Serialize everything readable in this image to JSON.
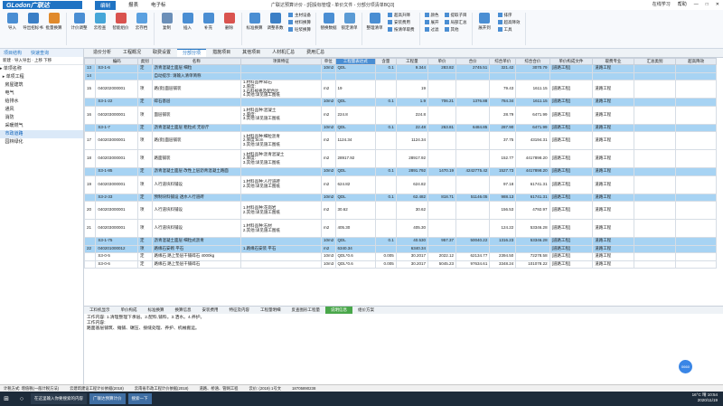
{
  "app": {
    "logo": "GLodon广联达",
    "window_title": "广联达预算计价 - [招投标管理 - 单价文件 - 分部分项清单BQ3]",
    "menu": [
      "编制",
      "报表",
      "电子标"
    ],
    "right": [
      "在线学习",
      "帮助"
    ]
  },
  "ribbon": {
    "big": [
      "导入",
      "导出招标书",
      "批量换算",
      "计价调整",
      "云检查",
      "智能组价",
      "云存档",
      "复制",
      "插入",
      "补充",
      "删除",
      "标准换算",
      "调整系数",
      "主材设备",
      "材料换算",
      "砼浆换算",
      "替换数据",
      "锁定清单",
      "整理清单",
      "排序",
      "超高降效",
      "展开到",
      "局部汇总",
      "工具"
    ],
    "small": [
      "超高升降",
      "安装费用",
      "按清单取费",
      "提取子目",
      "颜色",
      "展开",
      "过滤",
      "其他"
    ]
  },
  "left": {
    "tabs": [
      "项目结构",
      "快速查询"
    ],
    "toolbar": "新建 · 导入导出 · 上移 下移",
    "tree": [
      "▸ 单项名称",
      "  ▸ 单项工程",
      "    房屋建筑",
      "    电气",
      "    给排水",
      "    通风",
      "    消防",
      "    采暖燃气",
      "    市政道路",
      "    园林绿化"
    ]
  },
  "main_tabs": [
    "造价分析",
    "工程概况",
    "取费设置",
    "分部分项",
    "措施项目",
    "其他项目",
    "人材机汇总",
    "费用汇总"
  ],
  "columns": [
    "",
    "编码",
    "类别",
    "名称",
    "项目特征",
    "单位",
    "工程量表达式",
    "含量",
    "工程量",
    "单价",
    "合价",
    "综合单价",
    "综合合价",
    "单价构成文件",
    "取费专业",
    "汇总类别",
    "超高降效"
  ],
  "rows": [
    {
      "c": "blue",
      "n": "13",
      "code": "S3-1-6",
      "lb": "定",
      "name": "沥青混凝土面层 细粒",
      "tz": "",
      "dw": "10m2",
      "expr": "QDL",
      "hl": "0.1",
      "gcl": "9.344",
      "dj": "283.82",
      "hj": "2745.51",
      "zhdj": "321.42",
      "zhhj": "3070.79",
      "wj": "[道路工程]",
      "zy": "道路工程"
    },
    {
      "c": "blue",
      "n": "14",
      "code": "",
      "lb": "",
      "name": "自动提示: 请输入清单简称",
      "tz": "",
      "dw": "",
      "expr": "",
      "hl": "",
      "gcl": "",
      "dj": "",
      "hj": "",
      "zhdj": "",
      "zhhj": "",
      "wj": "",
      "zy": ""
    },
    {
      "c": "white",
      "n": "15",
      "code": "040202000001",
      "lb": "项",
      "name": "路(街)面层铺装",
      "tz": "1.材料品种:碎石\n2.厚度:\n3.石料规格及配合比\n4.其他:详见施工图纸",
      "dw": "m2",
      "expr": "19",
      "hl": "",
      "gcl": "19",
      "dj": "",
      "hj": "",
      "zhdj": "79.43",
      "zhhj": "1611.15",
      "wj": "[道路工程]",
      "zy": "道路工程"
    },
    {
      "c": "blue",
      "n": "",
      "code": "S3-1-22",
      "lb": "定",
      "name": "碎石基层",
      "tz": "",
      "dw": "10m2",
      "expr": "QDL",
      "hl": "0.1",
      "gcl": "1.9",
      "dj": "706.21",
      "hj": "1376.88",
      "zhdj": "784.34",
      "zhhj": "1611.15",
      "wj": "[道路工程]",
      "zy": "道路工程"
    },
    {
      "c": "white",
      "n": "16",
      "code": "040203000001",
      "lb": "项",
      "name": "面层铺装",
      "tz": "1.材料品种:混凝土\n2.厚度:\n3.其他:详见施工图纸",
      "dw": "m2",
      "expr": "224.8",
      "hl": "",
      "gcl": "224.8",
      "dj": "",
      "hj": "",
      "zhdj": "28.79",
      "zhhj": "6471.99",
      "wj": "[道路工程]",
      "zy": "道路工程"
    },
    {
      "c": "blue",
      "n": "",
      "code": "S3-1-7",
      "lb": "定",
      "name": "沥青混凝土面层 粗粒式 无砂斤",
      "tz": "",
      "dw": "10m2",
      "expr": "QDL",
      "hl": "0.1",
      "gcl": "22.48",
      "dj": "263.81",
      "hj": "6484.85",
      "zhdj": "287.90",
      "zhhj": "6471.99",
      "wj": "[道路工程]",
      "zy": "道路工程"
    },
    {
      "c": "white",
      "n": "17",
      "code": "040203000001",
      "lb": "项",
      "name": "路(街)面层铺装",
      "tz": "1.材料品种:细粒沥青\n2.厚度:5cm\n3.其他:详见施工图纸",
      "dw": "m2",
      "expr": "1124.34",
      "hl": "",
      "gcl": "1124.34",
      "dj": "",
      "hj": "",
      "zhdj": "37.75",
      "zhhj": "43194.31",
      "wj": "[道路工程]",
      "zy": "道路工程"
    },
    {
      "c": "white",
      "n": "18",
      "code": "040203000001",
      "lb": "项",
      "name": "路面铺装",
      "tz": "1.材料品种:沥青混凝土\n2.厚度:\n3.其他:详见施工图纸",
      "dw": "m2",
      "expr": "28917.92",
      "hl": "",
      "gcl": "28917.92",
      "dj": "",
      "hj": "",
      "zhdj": "152.77",
      "zhhj": "4417898.20",
      "wj": "[道路工程]",
      "zy": "道路工程"
    },
    {
      "c": "blue",
      "n": "",
      "code": "S3-1-85",
      "lb": "定",
      "name": "沥青混凝土面层 改性上层沥青混凝土路面",
      "tz": "",
      "dw": "10m2",
      "expr": "QDL",
      "hl": "0.1",
      "gcl": "2891.792",
      "dj": "1470.19",
      "hj": "4242775.42",
      "zhdj": "1527.73",
      "zhhj": "4417898.20",
      "wj": "[道路工程]",
      "zy": "道路工程"
    },
    {
      "c": "white",
      "n": "19",
      "code": "040203000001",
      "lb": "项",
      "name": "人行道块料铺设",
      "tz": "1.材料品种:人行道砖\n2.其他:详见施工图纸",
      "dw": "m2",
      "expr": "624.82",
      "hl": "",
      "gcl": "624.82",
      "dj": "",
      "hj": "",
      "zhdj": "97.18",
      "zhhj": "61741.31",
      "wj": "[道路工程]",
      "zy": "道路工程"
    },
    {
      "c": "blue",
      "n": "",
      "code": "S3-2-33",
      "lb": "定",
      "name": "预制块料铺设 透水人行道砖",
      "tz": "",
      "dw": "10m2",
      "expr": "QDL",
      "hl": "0.1",
      "gcl": "62.482",
      "dj": "818.71",
      "hj": "51146.05",
      "zhdj": "988.13",
      "zhhj": "61741.31",
      "wj": "[道路工程]",
      "zy": "道路工程"
    },
    {
      "c": "white",
      "n": "20",
      "code": "040203000001",
      "lb": "项",
      "name": "人行道块料铺设",
      "tz": "1.材料品种:花岗岩\n2.其他:详见施工图纸",
      "dw": "m2",
      "expr": "30.62",
      "hl": "",
      "gcl": "30.62",
      "dj": "",
      "hj": "",
      "zhdj": "156.53",
      "zhhj": "4792.97",
      "wj": "[道路工程]",
      "zy": "道路工程"
    },
    {
      "c": "white",
      "n": "21",
      "code": "040203000001",
      "lb": "项",
      "name": "人行道块料铺设",
      "tz": "1.材料品种:石材\n2.其他:详见施工图纸",
      "dw": "m2",
      "expr": "405.30",
      "hl": "",
      "gcl": "405.30",
      "dj": "",
      "hj": "",
      "zhdj": "124.22",
      "zhhj": "53346.28",
      "wj": "[道路工程]",
      "zy": "道路工程"
    },
    {
      "c": "blue",
      "n": "",
      "code": "S3-1-75",
      "lb": "定",
      "name": "沥青混凝土面层 细粒式沥青",
      "tz": "",
      "dw": "10m2",
      "expr": "QDL",
      "hl": "0.1",
      "gcl": "40.530",
      "dj": "957.37",
      "hj": "50040.22",
      "zhdj": "1316.23",
      "zhhj": "53346.28",
      "wj": "[道路工程]",
      "zy": "道路工程"
    },
    {
      "c": "blue",
      "n": "22",
      "code": "040201000012",
      "lb": "项",
      "name": "路缘石安砌 平石",
      "tz": "1.路缘石安装 平石",
      "dw": "m2",
      "expr": "6340.34",
      "hl": "",
      "gcl": "6340.34",
      "dj": "",
      "hj": "",
      "zhdj": "",
      "zhhj": "",
      "wj": "[道路工程]",
      "zy": "道路工程"
    },
    {
      "c": "white",
      "n": "",
      "code": "S3-0-5",
      "lb": "定",
      "name": "路缘石 路上垫层干铺碎石 4000kg",
      "tz": "",
      "dw": "10m3",
      "expr": "QDL*0.6",
      "hl": "0.005",
      "gcl": "30.2017",
      "dj": "2022.12",
      "hj": "62134.77",
      "zhdj": "2394.50",
      "zhhj": "72278.58",
      "wj": "[道路工程]",
      "zy": "道路工程"
    },
    {
      "c": "white",
      "n": "",
      "code": "S3-0-6",
      "lb": "定",
      "name": "路缘石 路上垫层干铺碎石",
      "tz": "",
      "dw": "10m3",
      "expr": "QDL*0.6",
      "hl": "0.005",
      "gcl": "30.2017",
      "dj": "5045.23",
      "hj": "97634.61",
      "zhdj": "3348.24",
      "zhhj": "101078.22",
      "wj": "[道路工程]",
      "zy": "道路工程"
    }
  ],
  "bottom_tabs": [
    "工料机显示",
    "单价构成",
    "标准换算",
    "换算信息",
    "安装费用",
    "特征及内容",
    "工程量明细",
    "反查图形工程量",
    "说明信息",
    "组价方案"
  ],
  "bottom_panel": {
    "header": "工作内容: 1.清理整理下承层。2.配料,铺料。3.洒水。4.养护。",
    "text": "工作内容:\n路面基层铺筑、摊铺、碾压、接缝处理、养护、机械搬运。"
  },
  "fab": "0660",
  "status": [
    "计税方式: 增值税(一般计税方法)",
    "云建筑建设工程计价依据(2018)",
    "云南省市政工程计价依据(2018)",
    "道路、桥涵、管网工程",
    "云价: (2019) 1号文",
    "18705890238"
  ],
  "taskbar": {
    "search": "在这里输入你要搜索的内容",
    "app1": "广联达预算计价",
    "app2": "搜索一下",
    "temp": "16°C",
    "weather": "晴",
    "time": "10:54",
    "date": "2020/11/19"
  }
}
